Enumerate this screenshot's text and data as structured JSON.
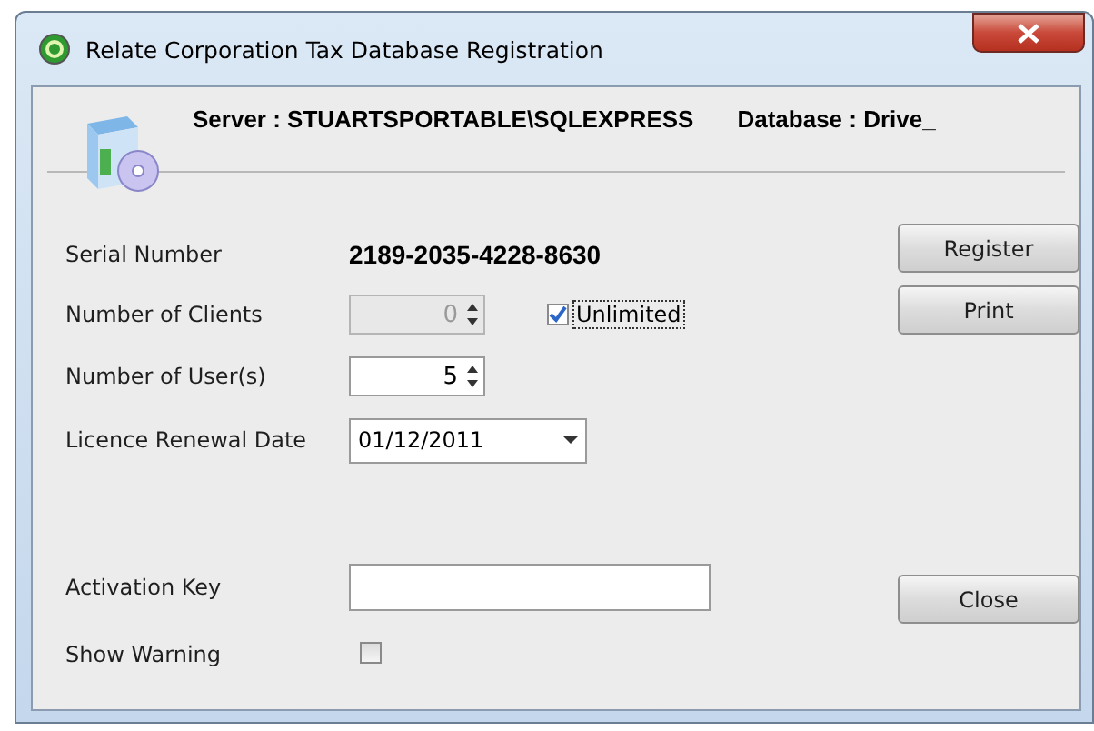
{
  "window": {
    "title": "Relate Corporation Tax Database Registration"
  },
  "header": {
    "server": "Server : STUARTSPORTABLE\\SQLEXPRESS",
    "database": "Database : Drive_"
  },
  "fields": [
    {
      "kind": "text",
      "label": "Serial Number",
      "value": "2189-2035-4228-8630"
    },
    {
      "kind": "spinner",
      "label": "Number of Clients",
      "value": "0",
      "disabled": true,
      "option": {
        "label": "Unlimited",
        "checked": true
      }
    },
    {
      "kind": "spinner",
      "label": "Number of User(s)",
      "value": "5",
      "disabled": false
    },
    {
      "kind": "date",
      "label": "Licence Renewal Date",
      "value": "01/12/2011"
    },
    {
      "kind": "gap"
    },
    {
      "kind": "input",
      "label": "Activation Key"
    },
    {
      "kind": "checkbox",
      "label": "Show Warning",
      "checked": false
    }
  ],
  "top_buttons": [
    {
      "label": "Register"
    },
    {
      "label": "Print"
    }
  ],
  "bottom_buttons": [
    {
      "label": "Close"
    }
  ]
}
